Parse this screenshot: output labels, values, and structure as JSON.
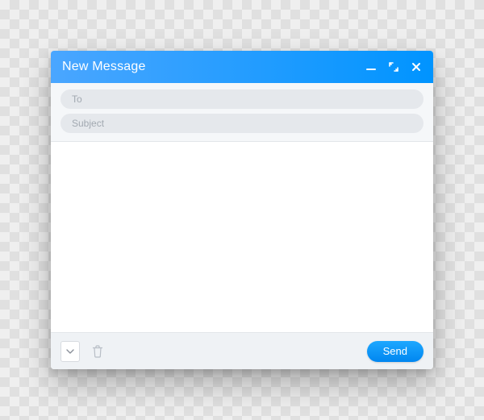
{
  "window": {
    "title": "New Message",
    "to_placeholder": "To",
    "to_value": "",
    "subject_placeholder": "Subject",
    "subject_value": "",
    "body_value": "",
    "send_label": "Send"
  },
  "icons": {
    "minimize": "minimize-icon",
    "expand": "expand-icon",
    "close": "close-icon",
    "more": "chevron-down-icon",
    "trash": "trash-icon"
  },
  "colors": {
    "accent_start": "#4aa6ff",
    "accent_end": "#0094ff",
    "send_start": "#1ea8ff",
    "send_end": "#0086f0"
  }
}
